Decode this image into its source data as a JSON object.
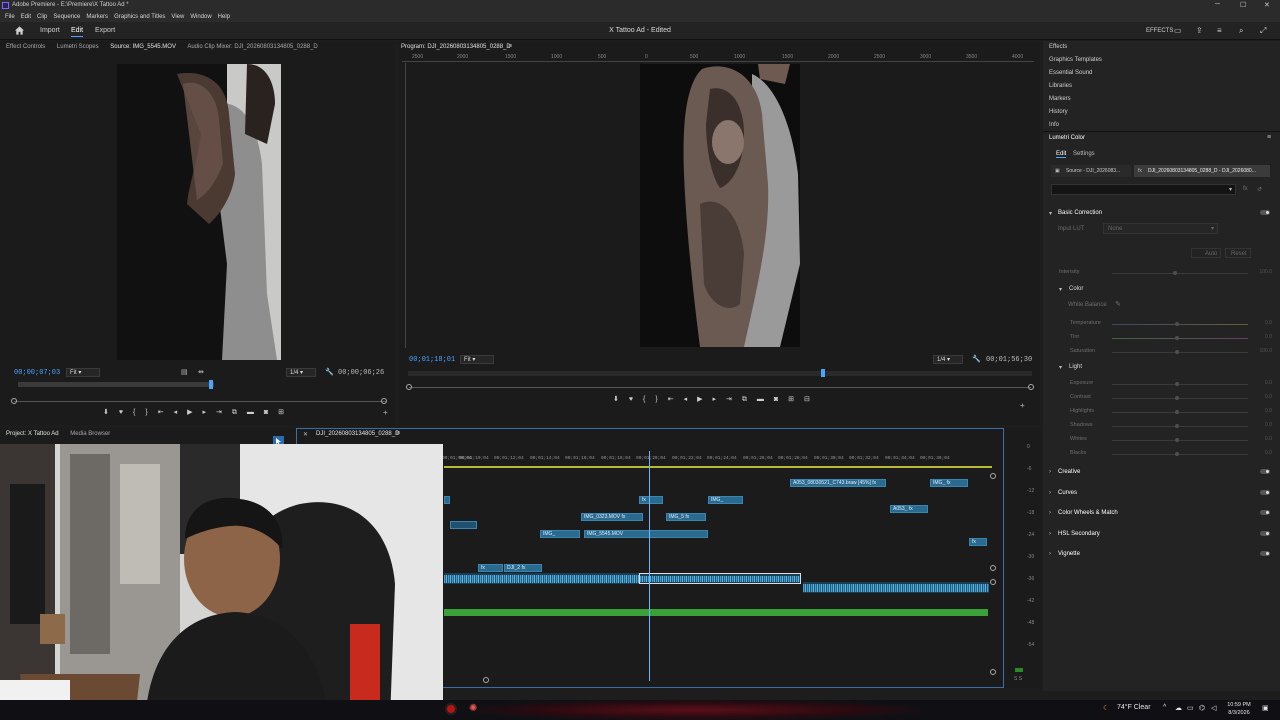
{
  "titlebar": {
    "title": "Adobe Premiere - E:\\Premiere\\X Tattoo Ad *",
    "minimize": "─",
    "maximize": "☐",
    "close": "✕"
  },
  "menubar": {
    "items": [
      "File",
      "Edit",
      "Clip",
      "Sequence",
      "Markers",
      "Graphics and Titles",
      "View",
      "Window",
      "Help"
    ]
  },
  "header": {
    "tabs": [
      "Import",
      "Edit",
      "Export"
    ],
    "active_tab": "Edit",
    "document_title": "X Tattoo Ad - Edited",
    "effects_label": "EFFECTS"
  },
  "source_panel": {
    "tabs": [
      "Effect Controls",
      "Lumetri Scopes",
      "Source: IMG_5545.MOV",
      "Audio Clip Mixer: DJI_20260803134805_0288_D"
    ],
    "active_tab": "Source: IMG_5545.MOV",
    "timecode_current": "00;00;07;03",
    "fit_label": "Fit",
    "resolution": "1/4",
    "timecode_duration": "00;00;06;26"
  },
  "program_panel": {
    "title": "Program: DJI_20260803134805_0288_D",
    "ruler_ticks": [
      "2500",
      "2000",
      "1500",
      "1000",
      "500",
      "0",
      "500",
      "1000",
      "1500",
      "2000",
      "2500",
      "3000",
      "3500",
      "4000"
    ],
    "timecode_current": "00;01;18;01",
    "fit_label": "Fit",
    "resolution": "1/4",
    "timecode_duration": "00;01;56;30"
  },
  "project_panel": {
    "tabs": [
      "Project: X Tattoo Ad",
      "Media Browser"
    ],
    "active_tab": "Project: X Tattoo Ad"
  },
  "timeline": {
    "sequence_name": "DJI_20260803134805_0288_D",
    "ruler": [
      "00;01;08;04",
      "00;01;10;04",
      "00;01;12;04",
      "00;01;14;04",
      "00;01;16;04",
      "00;01;18;04",
      "00;01;20;04",
      "00;01;22;04",
      "00;01;24;04",
      "00;01;26;04",
      "00;01;28;04",
      "00;01;30;04",
      "00;01;32;04",
      "00;01;34;04",
      "00;01;36;04"
    ],
    "clips": {
      "a053_big": "A053_08030521_C743.braw [45%]",
      "img_right": "IMG_",
      "fx": "fx",
      "img_mid": "IMG_",
      "a053_small": "A053_",
      "img_0323": "IMG_0323.MOV",
      "img_5": "IMG_5",
      "img_left": "IMG_",
      "img_5545": "IMG_5545.MOV",
      "dji_small": "DJI_2"
    }
  },
  "meter": {
    "labels": [
      "0",
      "-6",
      "-12",
      "-18",
      "-24",
      "-30",
      "-36",
      "-42",
      "-48",
      "-54"
    ],
    "bottom": "S S"
  },
  "right_panel": {
    "items": [
      "Effects",
      "Graphics Templates",
      "Essential Sound",
      "Libraries",
      "Markers",
      "History",
      "Info"
    ],
    "lumetri": {
      "title": "Lumetri Color",
      "tabs": [
        "Edit",
        "Settings"
      ],
      "source_label": "Source - DJI_2026083...",
      "clip_label": "DJI_20260803134805_0288_D - DJI_2026080...",
      "basic_correction": "Basic Correction",
      "input_lut_label": "Input LUT",
      "input_lut_value": "None",
      "auto": "Auto",
      "reset": "Reset",
      "intensity": {
        "label": "Intensity",
        "value": "100.0"
      },
      "color_section": "Color",
      "white_balance": "White Balance",
      "color_sliders": [
        {
          "label": "Temperature",
          "value": "0.0"
        },
        {
          "label": "Tint",
          "value": "0.0"
        },
        {
          "label": "Saturation",
          "value": "100.0"
        }
      ],
      "light_section": "Light",
      "light_sliders": [
        {
          "label": "Exposure",
          "value": "0.0"
        },
        {
          "label": "Contrast",
          "value": "0.0"
        },
        {
          "label": "Highlights",
          "value": "0.0"
        },
        {
          "label": "Shadows",
          "value": "0.0"
        },
        {
          "label": "Whites",
          "value": "0.0"
        },
        {
          "label": "Blacks",
          "value": "0.0"
        }
      ],
      "sections": [
        "Creative",
        "Curves",
        "Color Wheels & Match",
        "HSL Secondary",
        "Vignette"
      ]
    }
  },
  "taskbar": {
    "weather": "74°F Clear",
    "time": "10:59 PM",
    "date": "8/3/2026"
  },
  "colors": {
    "accent": "#4aa3ff",
    "clip_video": "#2b6a8f",
    "clip_audio_green": "#3aa03a",
    "panel_bg": "#1b1b1b"
  }
}
